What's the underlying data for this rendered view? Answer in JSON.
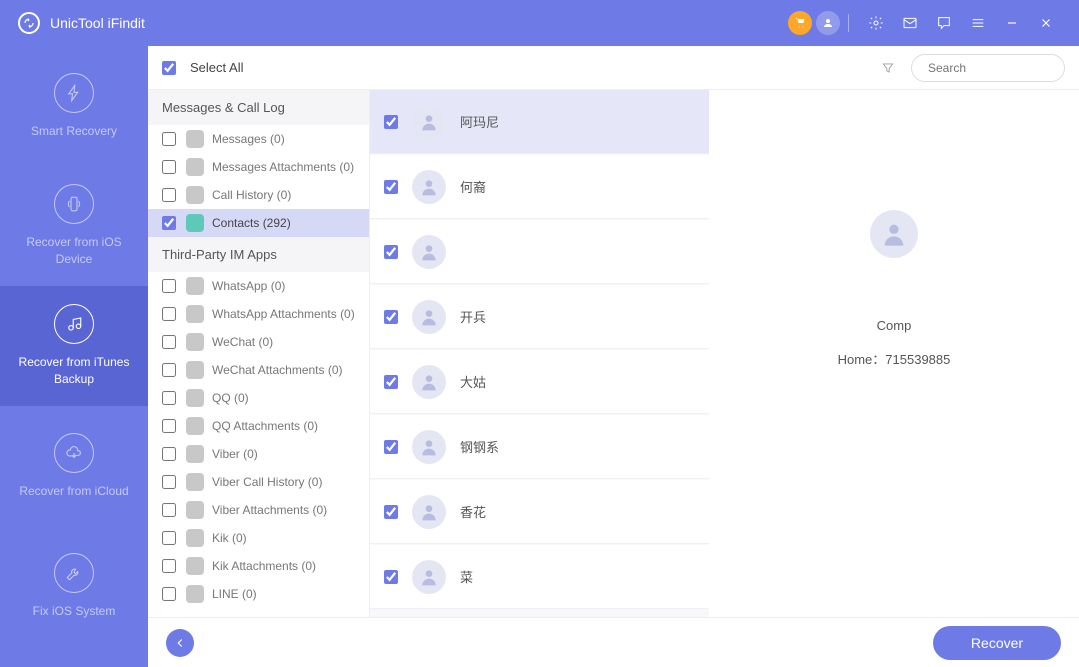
{
  "app_title": "UnicTool iFindit",
  "sidebar": {
    "items": [
      {
        "label": "Smart Recovery"
      },
      {
        "label": "Recover from iOS Device"
      },
      {
        "label": "Recover from iTunes Backup"
      },
      {
        "label": "Recover from iCloud"
      },
      {
        "label": "Fix iOS System"
      }
    ],
    "active_index": 2
  },
  "toolbar": {
    "select_all": "Select All",
    "search_placeholder": "Search"
  },
  "categories": {
    "groups": [
      {
        "title": "Messages & Call Log",
        "items": [
          {
            "label": "Messages (0)",
            "checked": false
          },
          {
            "label": "Messages Attachments (0)",
            "checked": false
          },
          {
            "label": "Call History (0)",
            "checked": false
          },
          {
            "label": "Contacts (292)",
            "checked": true,
            "active": true
          }
        ]
      },
      {
        "title": "Third-Party IM Apps",
        "items": [
          {
            "label": "WhatsApp (0)",
            "checked": false
          },
          {
            "label": "WhatsApp Attachments (0)",
            "checked": false
          },
          {
            "label": "WeChat (0)",
            "checked": false
          },
          {
            "label": "WeChat Attachments (0)",
            "checked": false
          },
          {
            "label": "QQ (0)",
            "checked": false
          },
          {
            "label": "QQ Attachments (0)",
            "checked": false
          },
          {
            "label": "Viber (0)",
            "checked": false
          },
          {
            "label": "Viber Call History (0)",
            "checked": false
          },
          {
            "label": "Viber Attachments (0)",
            "checked": false
          },
          {
            "label": "Kik (0)",
            "checked": false
          },
          {
            "label": "Kik Attachments (0)",
            "checked": false
          },
          {
            "label": "LINE (0)",
            "checked": false
          }
        ]
      }
    ]
  },
  "contacts": [
    {
      "name": "阿玛尼",
      "checked": true,
      "selected": true
    },
    {
      "name": "何裔",
      "checked": true
    },
    {
      "name": "",
      "checked": true
    },
    {
      "name": "开兵",
      "checked": true
    },
    {
      "name": "大姑",
      "checked": true
    },
    {
      "name": "钢钢系",
      "checked": true
    },
    {
      "name": "香花",
      "checked": true
    },
    {
      "name": "菜",
      "checked": true
    }
  ],
  "detail": {
    "name": "Comp",
    "home_label": "Home：",
    "home_value": "715539885"
  },
  "footer": {
    "recover": "Recover"
  }
}
